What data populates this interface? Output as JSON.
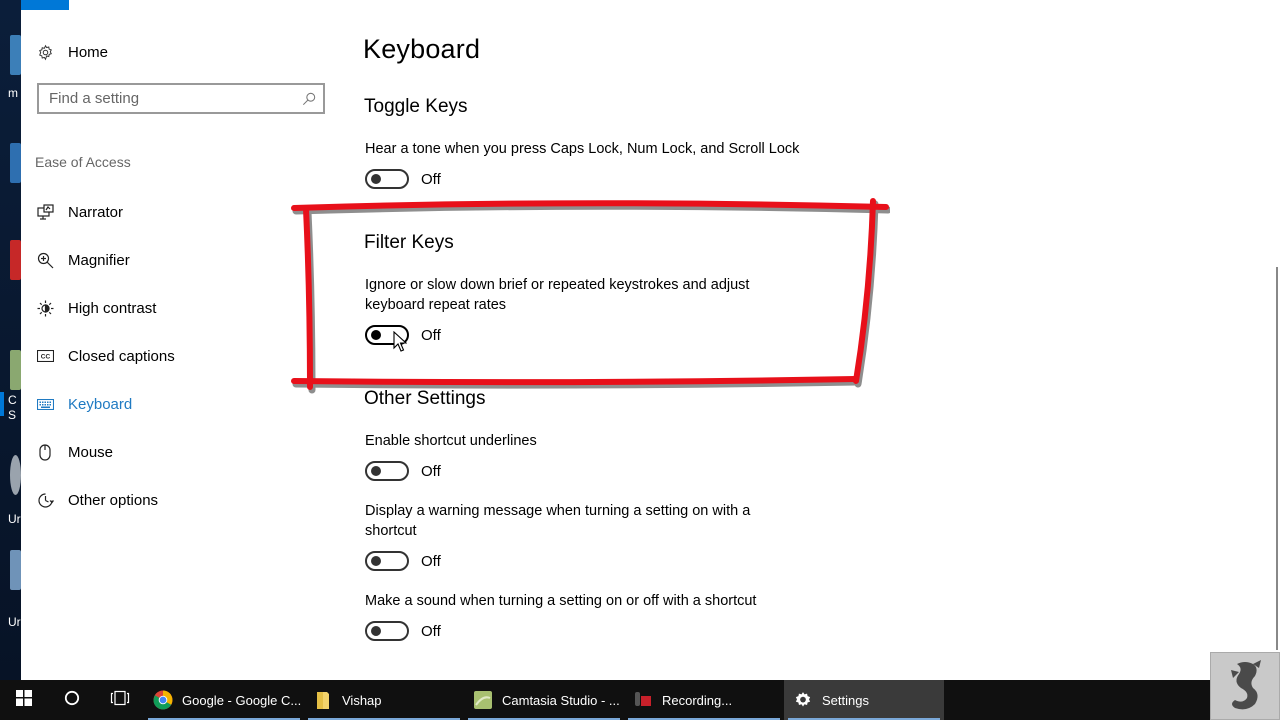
{
  "desktop": {
    "icon_labels": [
      "m",
      "C",
      "S",
      "Ur",
      "Ur"
    ]
  },
  "sidebar": {
    "home_label": "Home",
    "home_icon": "gear-icon",
    "search_placeholder": "Find a setting",
    "search_icon": "search-icon",
    "section_label": "Ease of Access",
    "items": [
      {
        "label": "Narrator",
        "icon": "narrator-icon",
        "active": false
      },
      {
        "label": "Magnifier",
        "icon": "magnifier-icon",
        "active": false
      },
      {
        "label": "High contrast",
        "icon": "high-contrast-icon",
        "active": false
      },
      {
        "label": "Closed captions",
        "icon": "closed-captions-icon",
        "active": false
      },
      {
        "label": "Keyboard",
        "icon": "keyboard-icon",
        "active": true
      },
      {
        "label": "Mouse",
        "icon": "mouse-icon",
        "active": false
      },
      {
        "label": "Other options",
        "icon": "other-options-icon",
        "active": false
      }
    ]
  },
  "main": {
    "title": "Keyboard",
    "groups": [
      {
        "title": "Toggle Keys",
        "settings": [
          {
            "description": "Hear a tone when you press Caps Lock, Num Lock, and Scroll Lock",
            "state": "Off"
          }
        ]
      },
      {
        "title": "Filter Keys",
        "settings": [
          {
            "description": "Ignore or slow down brief or repeated keystrokes and adjust keyboard repeat rates",
            "state": "Off"
          }
        ]
      },
      {
        "title": "Other Settings",
        "settings": [
          {
            "description": "Enable shortcut underlines",
            "state": "Off"
          },
          {
            "description": "Display a warning message when turning a setting on with a shortcut",
            "state": "Off"
          },
          {
            "description": "Make a sound when turning a setting on or off with a shortcut",
            "state": "Off"
          }
        ]
      }
    ]
  },
  "annotation": {
    "color": "#e8101a",
    "target": "Filter Keys"
  },
  "taskbar": {
    "start_icon": "windows-start-icon",
    "cortana_icon": "cortana-icon",
    "taskview_icon": "task-view-icon",
    "apps": [
      {
        "label": "Google - Google C...",
        "icon": "chrome-icon",
        "running": true,
        "active": false
      },
      {
        "label": "Vishap",
        "icon": "folder-icon",
        "running": true,
        "active": false
      },
      {
        "label": "Camtasia Studio - ...",
        "icon": "camtasia-icon",
        "running": true,
        "active": false
      },
      {
        "label": "Recording...",
        "icon": "recorder-icon",
        "running": true,
        "active": false
      },
      {
        "label": "Settings",
        "icon": "settings-gear-icon",
        "running": true,
        "active": true
      }
    ]
  },
  "colors": {
    "accent": "#0078d7",
    "active_nav_text": "#1f7ac2",
    "taskbar_bg": "#101010"
  }
}
